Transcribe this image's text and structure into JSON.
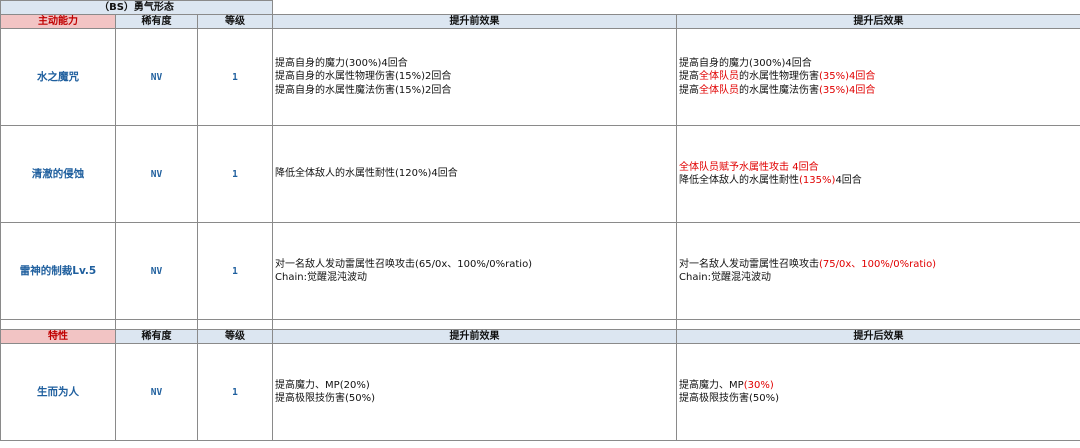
{
  "title": "（BS）勇气形态",
  "active": {
    "header": {
      "kind": "主动能力",
      "rarity": "稀有度",
      "level": "等级",
      "before": "提升前效果",
      "after": "提升后效果"
    },
    "rows": [
      {
        "name": "水之魔咒",
        "rarity": "NV",
        "level": "1",
        "before": [
          "提高自身的魔力(300%)4回合",
          "提高自身的水属性物理伤害(15%)2回合",
          "提高自身的水属性魔法伤害(15%)2回合"
        ],
        "after": [
          [
            {
              "t": "提高自身的魔力(300%)4回合",
              "hl": false
            }
          ],
          [
            {
              "t": "提高",
              "hl": false
            },
            {
              "t": "全体队员",
              "hl": true
            },
            {
              "t": "的水属性物理伤害",
              "hl": false
            },
            {
              "t": "(35%)4回合",
              "hl": true
            }
          ],
          [
            {
              "t": "提高",
              "hl": false
            },
            {
              "t": "全体队员",
              "hl": true
            },
            {
              "t": "的水属性魔法伤害",
              "hl": false
            },
            {
              "t": "(35%)4回合",
              "hl": true
            }
          ]
        ]
      },
      {
        "name": "清澈的侵蚀",
        "rarity": "NV",
        "level": "1",
        "before": [
          "降低全体敌人的水属性耐性(120%)4回合"
        ],
        "after": [
          [
            {
              "t": "全体队员赋予水属性攻击 4回合",
              "hl": true
            }
          ],
          [
            {
              "t": "降低全体敌人的水属性耐性",
              "hl": false
            },
            {
              "t": "(135%)",
              "hl": true
            },
            {
              "t": "4回合",
              "hl": false
            }
          ]
        ]
      },
      {
        "name": "雷神的制裁Lv.5",
        "rarity": "NV",
        "level": "1",
        "before": [
          "对一名敌人发动雷属性召唤攻击(65/0x、100%/0%ratio)",
          "Chain:觉醒混沌波动"
        ],
        "after": [
          [
            {
              "t": "对一名敌人发动雷属性召唤攻击",
              "hl": false
            },
            {
              "t": "(75/0x、100%/0%ratio)",
              "hl": true
            }
          ],
          [
            {
              "t": "Chain:觉醒混沌波动",
              "hl": false
            }
          ]
        ]
      }
    ]
  },
  "trait": {
    "header": {
      "kind": "特性",
      "rarity": "稀有度",
      "level": "等级",
      "before": "提升前效果",
      "after": "提升后效果"
    },
    "rows": [
      {
        "name": "生而为人",
        "rarity": "NV",
        "level": "1",
        "before": [
          "提高魔力、MP(20%)",
          "提高极限技伤害(50%)"
        ],
        "after": [
          [
            {
              "t": "提高魔力、MP",
              "hl": false
            },
            {
              "t": "(30%)",
              "hl": true
            }
          ],
          [
            {
              "t": "提高极限技伤害(50%)",
              "hl": false
            }
          ]
        ]
      }
    ]
  }
}
